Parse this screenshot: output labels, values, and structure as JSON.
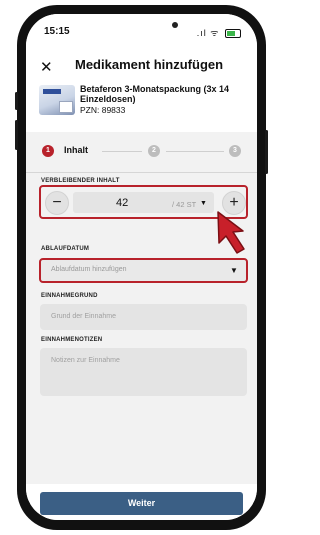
{
  "status_bar": {
    "time": "15:15",
    "signal_wifi": ".ıl ᯤ"
  },
  "header": {
    "close_label": "✕",
    "title": "Medikament hinzufügen",
    "medication_name": "Betaferon 3-Monatspackung (3x 14 Einzeldosen)",
    "pzn": "PZN: 89833"
  },
  "stepper": {
    "steps": [
      {
        "number": "1",
        "label": "Inhalt",
        "active": true
      },
      {
        "number": "2",
        "active": false
      },
      {
        "number": "3",
        "active": false
      }
    ]
  },
  "remaining": {
    "label": "VERBLEIBENDER INHALT",
    "minus_label": "−",
    "plus_label": "+",
    "value": "42",
    "unit": "/ 42 ST",
    "dropdown_caret": "▼"
  },
  "expiry": {
    "label": "ABLAUFDATUM",
    "placeholder": "Ablaufdatum hinzufügen",
    "dropdown_caret": "▼"
  },
  "reason": {
    "label": "EINNAHMEGRUND",
    "placeholder": "Grund der Einnahme"
  },
  "notes": {
    "label": "EINNAHMENOTIZEN",
    "placeholder": "Notizen zur Einnahme"
  },
  "footer": {
    "next_label": "Weiter"
  },
  "colors": {
    "accent": "#b8222b",
    "primary_button": "#3b5f85",
    "battery": "#3bb54a"
  }
}
